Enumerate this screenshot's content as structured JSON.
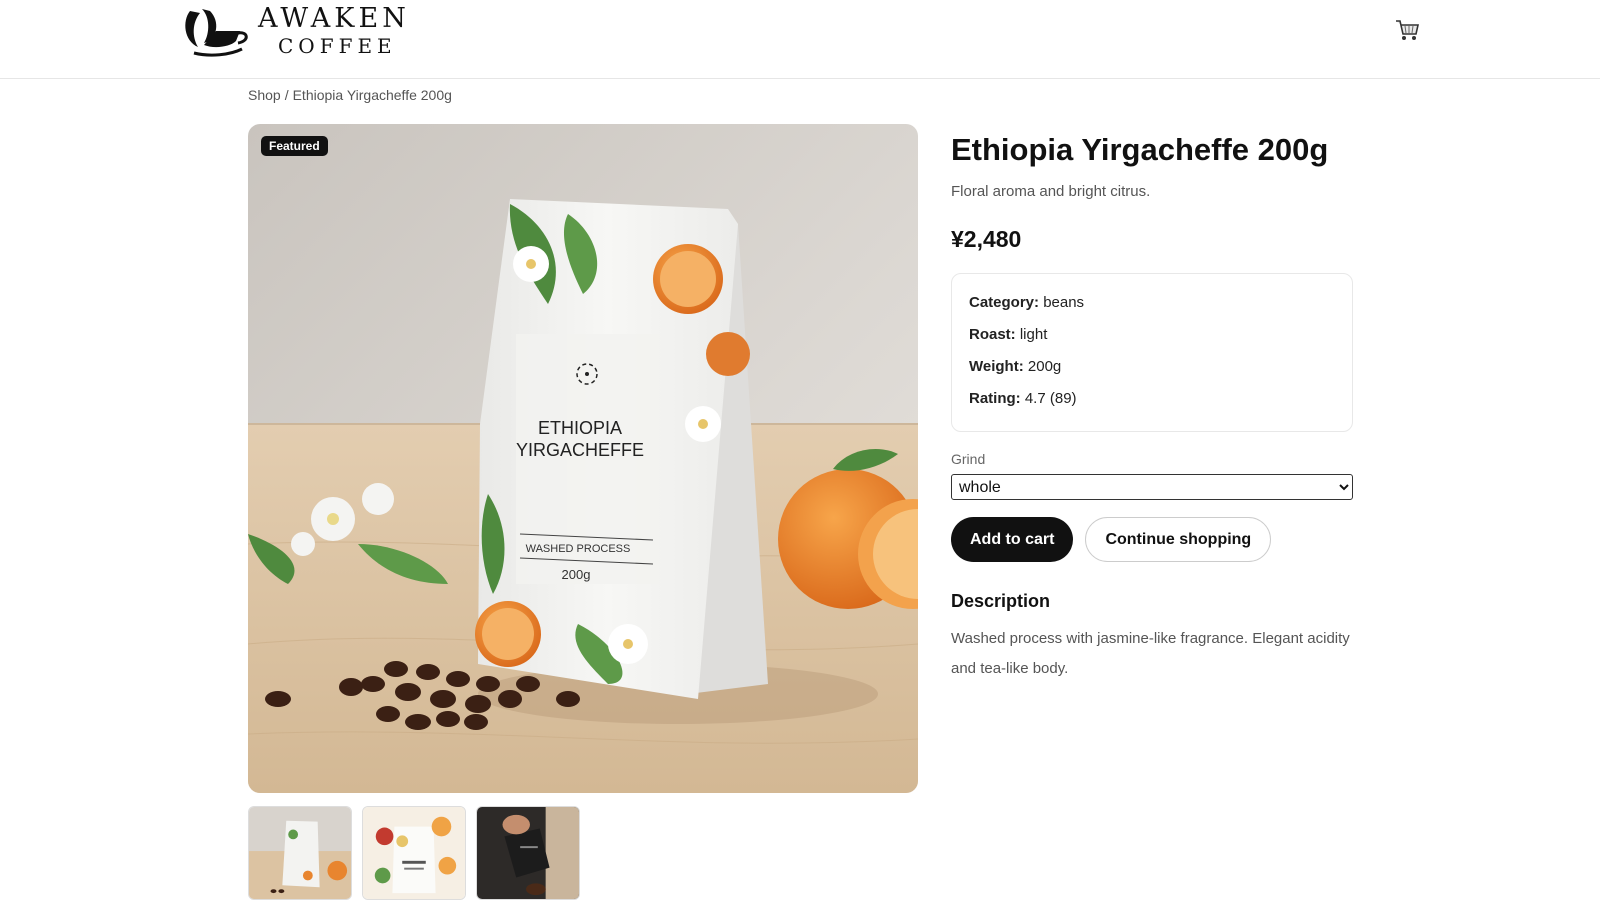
{
  "brand": {
    "line1": "AWAKEN",
    "line2": "COFFEE",
    "accent_color": "#111111"
  },
  "header": {
    "cart_icon": "shopping-cart-icon"
  },
  "breadcrumb": {
    "shop": "Shop",
    "separator": "/",
    "current": "Ethiopia Yirgacheffe 200g"
  },
  "gallery": {
    "badge": "Featured",
    "package_text": {
      "name_line1": "ETHIOPIA",
      "name_line2": "YIRGACHEFFE",
      "process": "WASHED PROCESS",
      "weight": "200g"
    },
    "thumbnails": [
      {
        "name": "thumbnail-bag-front"
      },
      {
        "name": "thumbnail-bag-floral"
      },
      {
        "name": "thumbnail-pouring-beans"
      }
    ]
  },
  "product": {
    "title": "Ethiopia Yirgacheffe 200g",
    "subtitle": "Floral aroma and bright citrus.",
    "price": "¥2,480",
    "specs": [
      {
        "key": "Category:",
        "value": "beans"
      },
      {
        "key": "Roast:",
        "value": "light"
      },
      {
        "key": "Weight:",
        "value": "200g"
      },
      {
        "key": "Rating:",
        "value": "4.7 (89)"
      }
    ],
    "grind_label": "Grind",
    "grind_selected": "whole",
    "add_to_cart": "Add to cart",
    "continue_shopping": "Continue shopping",
    "description_heading": "Description",
    "description": "Washed process with jasmine-like fragrance. Elegant acidity and tea-like body."
  }
}
